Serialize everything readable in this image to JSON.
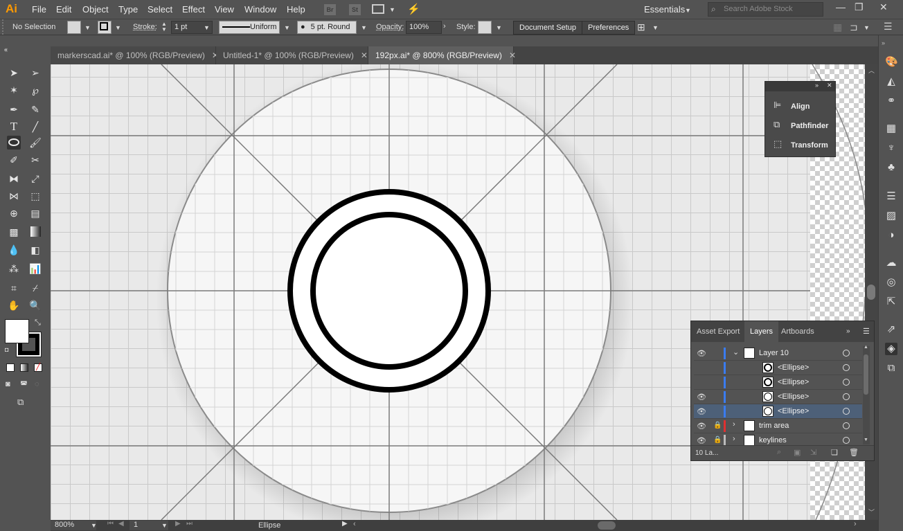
{
  "app": {
    "logo": "Ai"
  },
  "menu": [
    "File",
    "Edit",
    "Object",
    "Type",
    "Select",
    "Effect",
    "View",
    "Window",
    "Help"
  ],
  "bridge": {
    "br": "Br",
    "st": "St"
  },
  "workspace": "Essentials",
  "search_placeholder": "Search Adobe Stock",
  "control": {
    "selection": "No Selection",
    "stroke_label": "Stroke:",
    "stroke_value": "1 pt",
    "profile": "Uniform",
    "brush": "5 pt. Round",
    "opacity_label": "Opacity:",
    "opacity_value": "100%",
    "style_label": "Style:",
    "doc_setup": "Document Setup",
    "preferences": "Preferences"
  },
  "tabs": [
    {
      "label": "markerscad.ai* @ 100% (RGB/Preview)"
    },
    {
      "label": "Untitled-1* @ 100% (RGB/Preview)"
    },
    {
      "label": "192px.ai* @ 800% (RGB/Preview)"
    }
  ],
  "tab_close": "✕",
  "align_panel": {
    "items": [
      "Align",
      "Pathfinder",
      "Transform"
    ]
  },
  "layers_panel": {
    "tabs": [
      "Asset Export",
      "Layers",
      "Artboards"
    ],
    "rows": [
      {
        "name": "Layer 10",
        "eye": true,
        "lock": false,
        "expand": "⌄",
        "color": "#3a7cf0",
        "selected": false
      },
      {
        "name": "<Ellipse>",
        "eye": false,
        "lock": false,
        "expand": "",
        "color": "#3a7cf0",
        "selected": false
      },
      {
        "name": "<Ellipse>",
        "eye": false,
        "lock": false,
        "expand": "",
        "color": "#3a7cf0",
        "selected": false
      },
      {
        "name": "<Ellipse>",
        "eye": true,
        "lock": false,
        "expand": "",
        "color": "#3a7cf0",
        "selected": false
      },
      {
        "name": "<Ellipse>",
        "eye": true,
        "lock": false,
        "expand": "",
        "color": "#3a7cf0",
        "selected": true
      },
      {
        "name": "trim area",
        "eye": true,
        "lock": true,
        "expand": "›",
        "color": "#e03030",
        "selected": false
      },
      {
        "name": "keylines",
        "eye": true,
        "lock": true,
        "expand": "›",
        "color": "#bbbbbb",
        "selected": false
      }
    ],
    "count": "10 La..."
  },
  "status": {
    "zoom": "800%",
    "artboard": "1",
    "tool": "Ellipse"
  },
  "colors": {
    "accent": "#4d6078",
    "logo": "#ff9a00"
  }
}
